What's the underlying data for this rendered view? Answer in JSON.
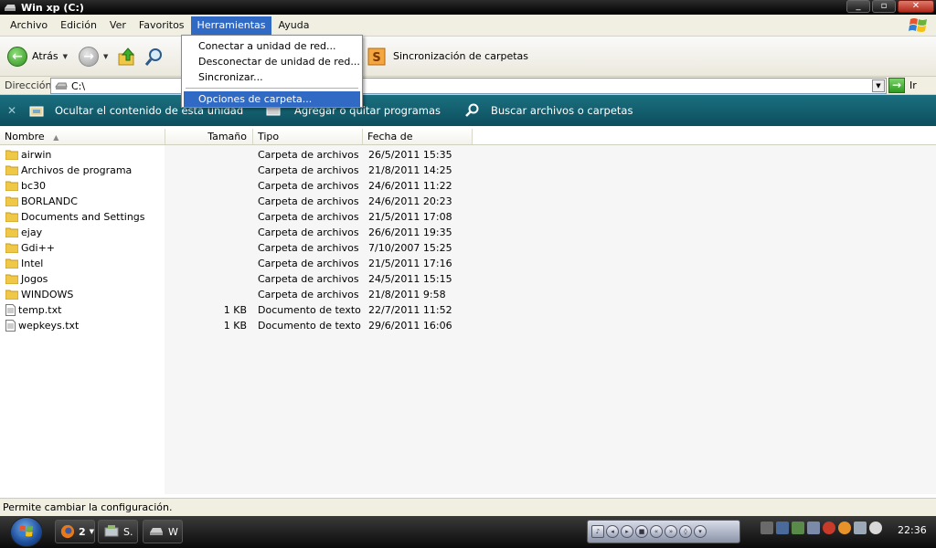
{
  "window": {
    "title": "Win xp (C:)"
  },
  "menubar": [
    "Archivo",
    "Edición",
    "Ver",
    "Favoritos",
    "Herramientas",
    "Ayuda"
  ],
  "toolbar": {
    "back": "Atrás",
    "sync": "Sincronización de carpetas"
  },
  "address": {
    "label": "Dirección",
    "value": "C:\\",
    "go": "Ir"
  },
  "taskband": {
    "hide": "Ocultar el contenido de esta unidad",
    "addremove": "Agregar o quitar programas",
    "search": "Buscar archivos o carpetas"
  },
  "columns": {
    "name": "Nombre",
    "size": "Tamaño",
    "type": "Tipo",
    "date": "Fecha de modificación"
  },
  "files": [
    {
      "name": "airwin",
      "size": "",
      "type": "Carpeta de archivos",
      "date": "26/5/2011 15:35",
      "kind": "folder"
    },
    {
      "name": "Archivos de programa",
      "size": "",
      "type": "Carpeta de archivos",
      "date": "21/8/2011 14:25",
      "kind": "folder"
    },
    {
      "name": "bc30",
      "size": "",
      "type": "Carpeta de archivos",
      "date": "24/6/2011 11:22",
      "kind": "folder"
    },
    {
      "name": "BORLANDC",
      "size": "",
      "type": "Carpeta de archivos",
      "date": "24/6/2011 20:23",
      "kind": "folder"
    },
    {
      "name": "Documents and Settings",
      "size": "",
      "type": "Carpeta de archivos",
      "date": "21/5/2011 17:08",
      "kind": "folder"
    },
    {
      "name": "ejay",
      "size": "",
      "type": "Carpeta de archivos",
      "date": "26/6/2011 19:35",
      "kind": "folder"
    },
    {
      "name": "Gdi++",
      "size": "",
      "type": "Carpeta de archivos",
      "date": "7/10/2007 15:25",
      "kind": "folder"
    },
    {
      "name": "Intel",
      "size": "",
      "type": "Carpeta de archivos",
      "date": "21/5/2011 17:16",
      "kind": "folder"
    },
    {
      "name": "Jogos",
      "size": "",
      "type": "Carpeta de archivos",
      "date": "24/5/2011 15:15",
      "kind": "folder"
    },
    {
      "name": "WINDOWS",
      "size": "",
      "type": "Carpeta de archivos",
      "date": "21/8/2011 9:58",
      "kind": "folder"
    },
    {
      "name": "temp.txt",
      "size": "1 KB",
      "type": "Documento de texto",
      "date": "22/7/2011 11:52",
      "kind": "text"
    },
    {
      "name": "wepkeys.txt",
      "size": "1 KB",
      "type": "Documento de texto",
      "date": "29/6/2011 16:06",
      "kind": "text"
    }
  ],
  "dropdown": {
    "map_drive": "Conectar a unidad de red...",
    "disconnect_drive": "Desconectar de unidad de red...",
    "synchronize": "Sincronizar...",
    "folder_options": "Opciones de carpeta..."
  },
  "status": "Permite cambiar la configuración.",
  "taskbar": {
    "firefox_count": "2",
    "task2": "S.",
    "task3": "W",
    "clock": "22:36"
  },
  "colors": {
    "accent": "#316ac5",
    "band": "#0d4e5e",
    "folder": "#f0c848"
  }
}
